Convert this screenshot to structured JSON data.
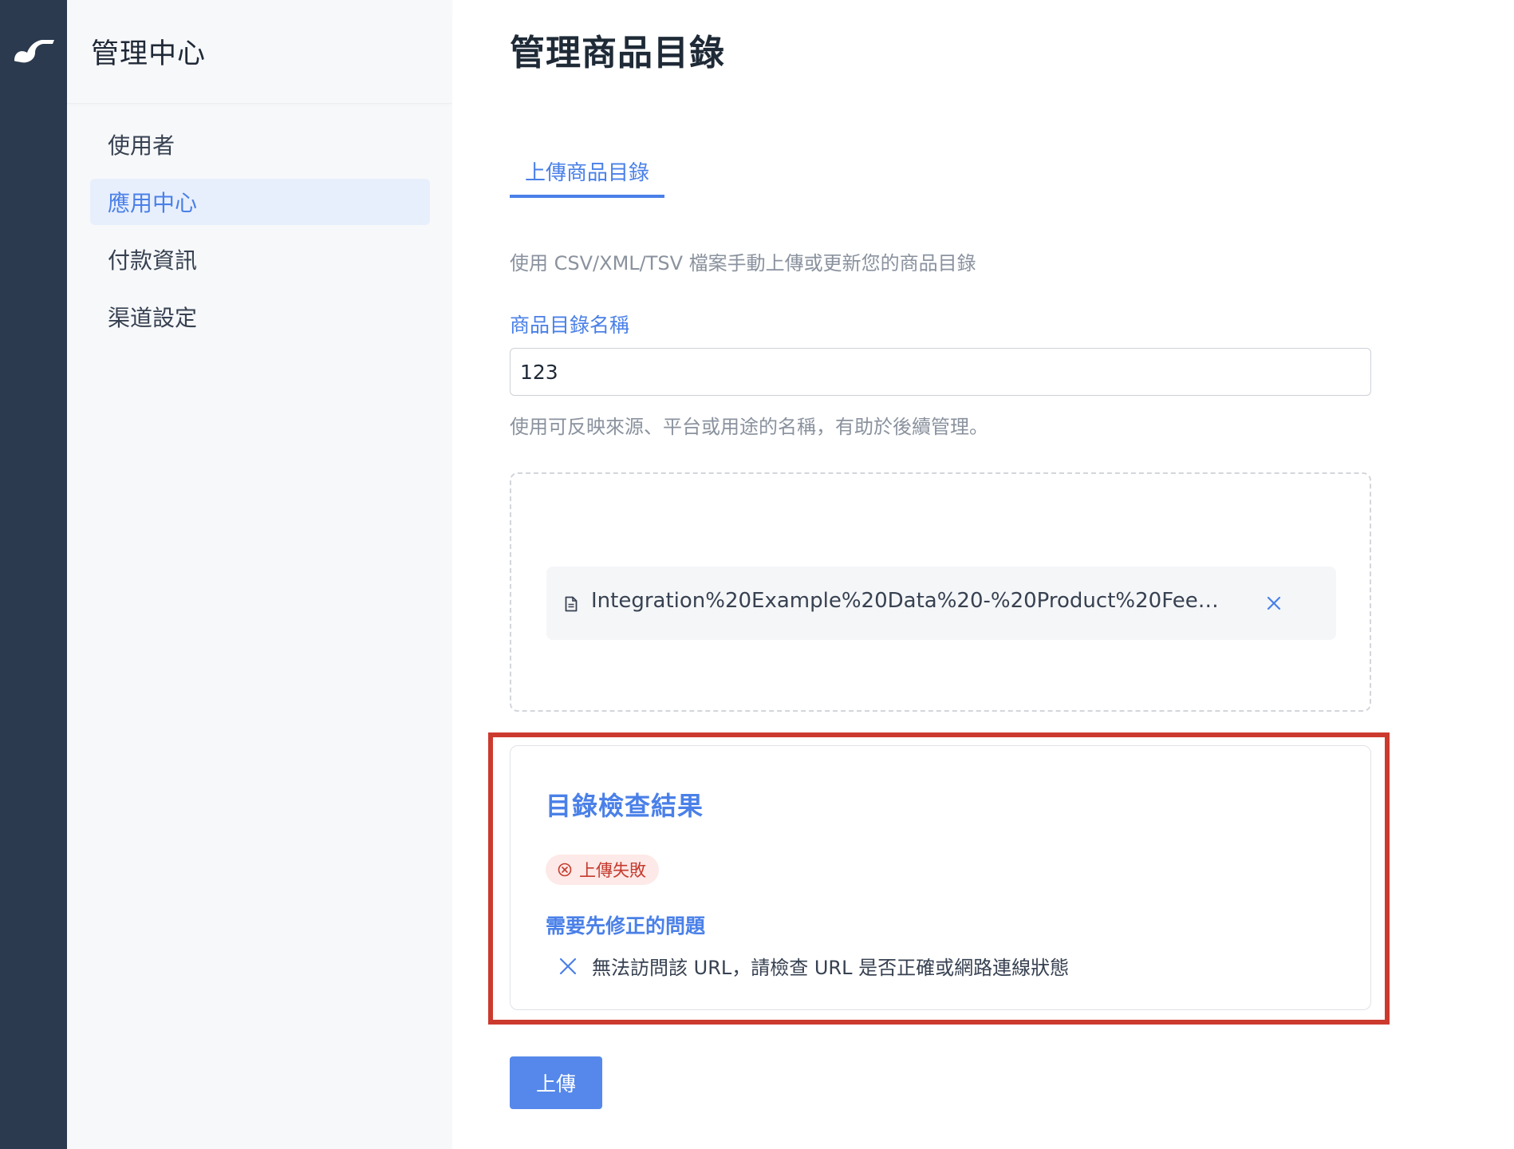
{
  "app": {
    "logo_icon": "brand-logo-icon",
    "admin_title": "管理中心"
  },
  "sidebar": {
    "items": [
      {
        "label": "使用者",
        "active": false
      },
      {
        "label": "應用中心",
        "active": true
      },
      {
        "label": "付款資訊",
        "active": false
      },
      {
        "label": "渠道設定",
        "active": false
      }
    ]
  },
  "main": {
    "page_title": "管理商品目錄",
    "tab_label": "上傳商品目錄",
    "description": "使用 CSV/XML/TSV 檔案手動上傳或更新您的商品目錄",
    "catalog_name_label": "商品目錄名稱",
    "catalog_name_value": "123",
    "catalog_name_hint": "使用可反映來源、平台或用途的名稱，有助於後續管理。",
    "file": {
      "icon": "document-icon",
      "name": "Integration%20Example%20Data%20-%20Product%20Feed%20-…",
      "remove_icon": "close-icon"
    },
    "check_result": {
      "title": "目錄檢查結果",
      "status_icon": "error-circle-icon",
      "status_label": "上傳失敗",
      "issues_title": "需要先修正的問題",
      "issues": [
        {
          "icon": "close-icon",
          "text": "無法訪問該 URL，請檢查 URL 是否正確或網路連線狀態"
        }
      ]
    },
    "upload_button_label": "上傳"
  },
  "colors": {
    "accent": "#4a80e8",
    "rail": "#2b3a4e",
    "error": "#c53a2e",
    "highlight_border": "#cc3a2e",
    "button": "#5588ea"
  }
}
